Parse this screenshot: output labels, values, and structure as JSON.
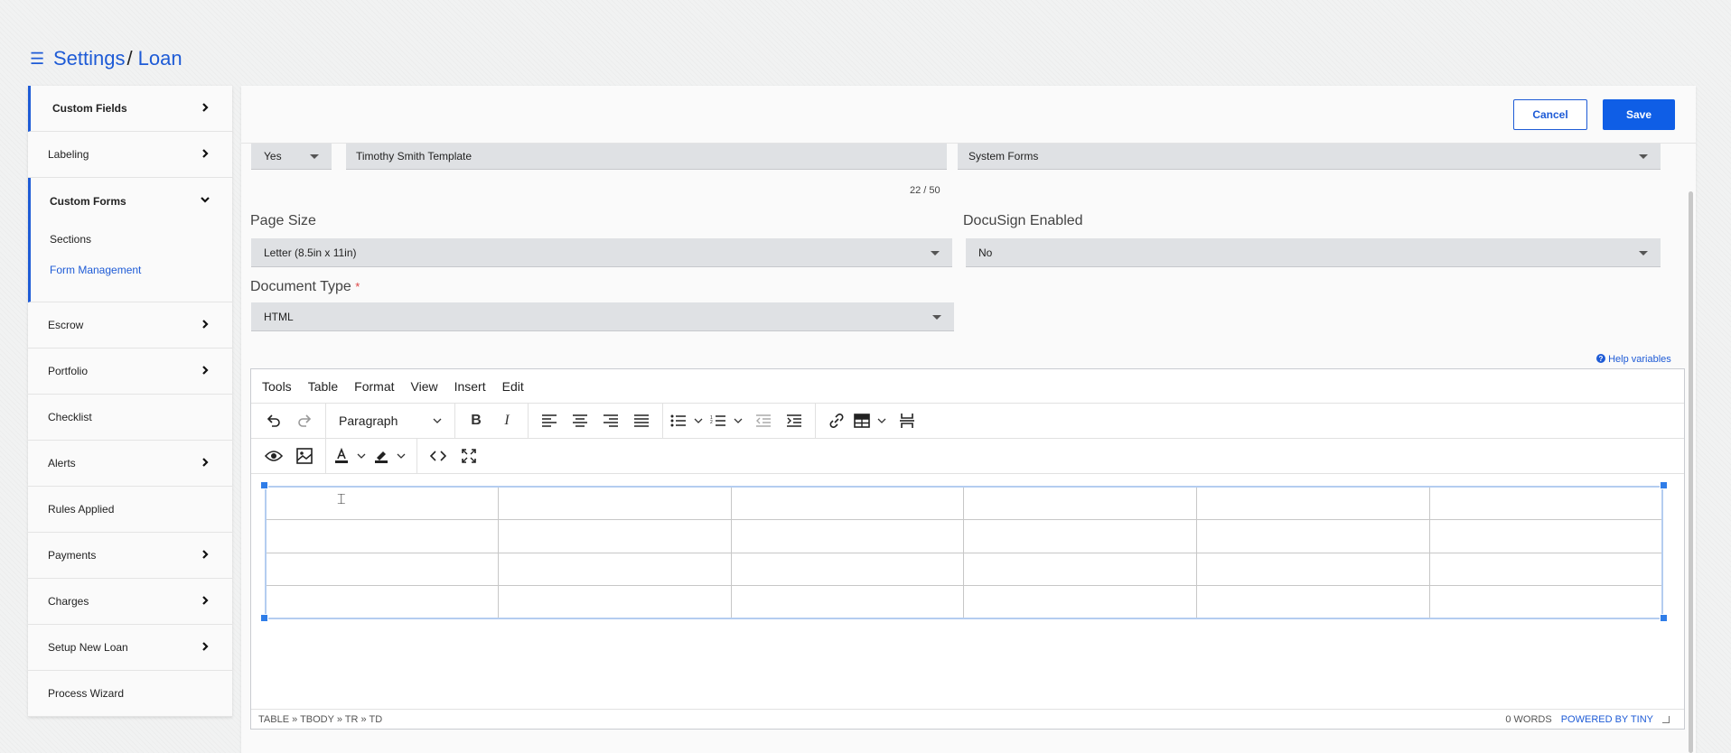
{
  "header": {
    "menu_icon": "hamburger-icon",
    "crumb": "Settings",
    "separator": "/",
    "current": "Loan"
  },
  "sidebar": {
    "items_top": [
      {
        "label": "Custom Fields",
        "bold": true,
        "active": true,
        "chevron": "right"
      },
      {
        "label": "Labeling",
        "chevron": "right"
      }
    ],
    "group": {
      "label": "Custom Forms",
      "chevron": "down",
      "subitems": [
        {
          "label": "Sections"
        },
        {
          "label": "Form Management",
          "selected": true
        }
      ]
    },
    "items_bottom": [
      {
        "label": "Escrow",
        "chevron": "right"
      },
      {
        "label": "Portfolio",
        "chevron": "right"
      },
      {
        "label": "Checklist"
      },
      {
        "label": "Alerts",
        "chevron": "right"
      },
      {
        "label": "Rules Applied"
      },
      {
        "label": "Payments",
        "chevron": "right"
      },
      {
        "label": "Charges",
        "chevron": "right"
      },
      {
        "label": "Setup New Loan",
        "chevron": "right"
      },
      {
        "label": "Process Wizard"
      }
    ]
  },
  "toolbar": {
    "cancel_label": "Cancel",
    "save_label": "Save"
  },
  "form": {
    "active_select": "Yes",
    "name_value": "Timothy Smith Template",
    "name_counter": "22 / 50",
    "category_select": "System Forms",
    "page_size_label": "Page Size",
    "page_size_value": "Letter (8.5in x 11in)",
    "docusign_label": "DocuSign Enabled",
    "docusign_value": "No",
    "doc_type_label": "Document Type",
    "doc_type_required": "*",
    "doc_type_value": "HTML",
    "help_variables": "Help variables"
  },
  "editor": {
    "menu": [
      "Tools",
      "Table",
      "Format",
      "View",
      "Insert",
      "Edit"
    ],
    "block_format": "Paragraph",
    "table": {
      "rows": 4,
      "cols": 6
    },
    "path": "TABLE » TBODY » TR » TD",
    "word_count": "0 WORDS",
    "powered_by": "POWERED BY TINY"
  },
  "colors": {
    "accent": "#1e5bd6",
    "save_bg": "#0f5ee6",
    "field_bg": "#dfe1e4"
  }
}
